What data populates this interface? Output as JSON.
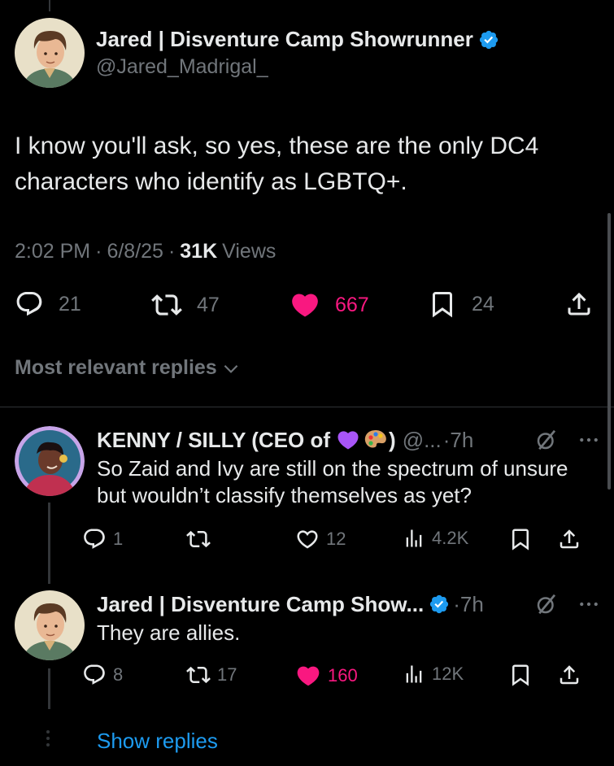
{
  "main_tweet": {
    "author_name": "Jared | Disventure Camp Showrunner",
    "handle": "@Jared_Madrigal_",
    "text": "I know you'll ask, so yes, these are the only DC4 characters who identify as LGBTQ+.",
    "time": "2:02 PM",
    "date": "6/8/25",
    "separator": "·",
    "views_count": "31K",
    "views_label": "Views",
    "replies": "21",
    "reposts": "47",
    "likes": "667",
    "bookmarks": "24"
  },
  "sort_label": "Most relevant replies",
  "replies": [
    {
      "author_name": "KENNY / SILLY (CEO of",
      "author_name_suffix": ")",
      "name_emojis": [
        "purple-heart",
        "artist-palette"
      ],
      "handle": "@...",
      "time": "·7h",
      "text": "So Zaid and Ivy are still on the spectrum of unsure but wouldn’t classify themselves as yet?",
      "replies": "1",
      "reposts": "",
      "likes": "12",
      "views": "4.2K"
    },
    {
      "author_name": "Jared | Disventure Camp Show...",
      "handle": "",
      "time": "·7h",
      "text": "They are allies.",
      "replies": "8",
      "reposts": "17",
      "likes": "160",
      "views": "12K"
    }
  ],
  "show_replies_label": "Show replies",
  "colors": {
    "background": "#000000",
    "text": "#e7e9ea",
    "muted": "#71767b",
    "like": "#f91880",
    "link": "#1d9bf0",
    "verified": "#1d9bf0"
  }
}
